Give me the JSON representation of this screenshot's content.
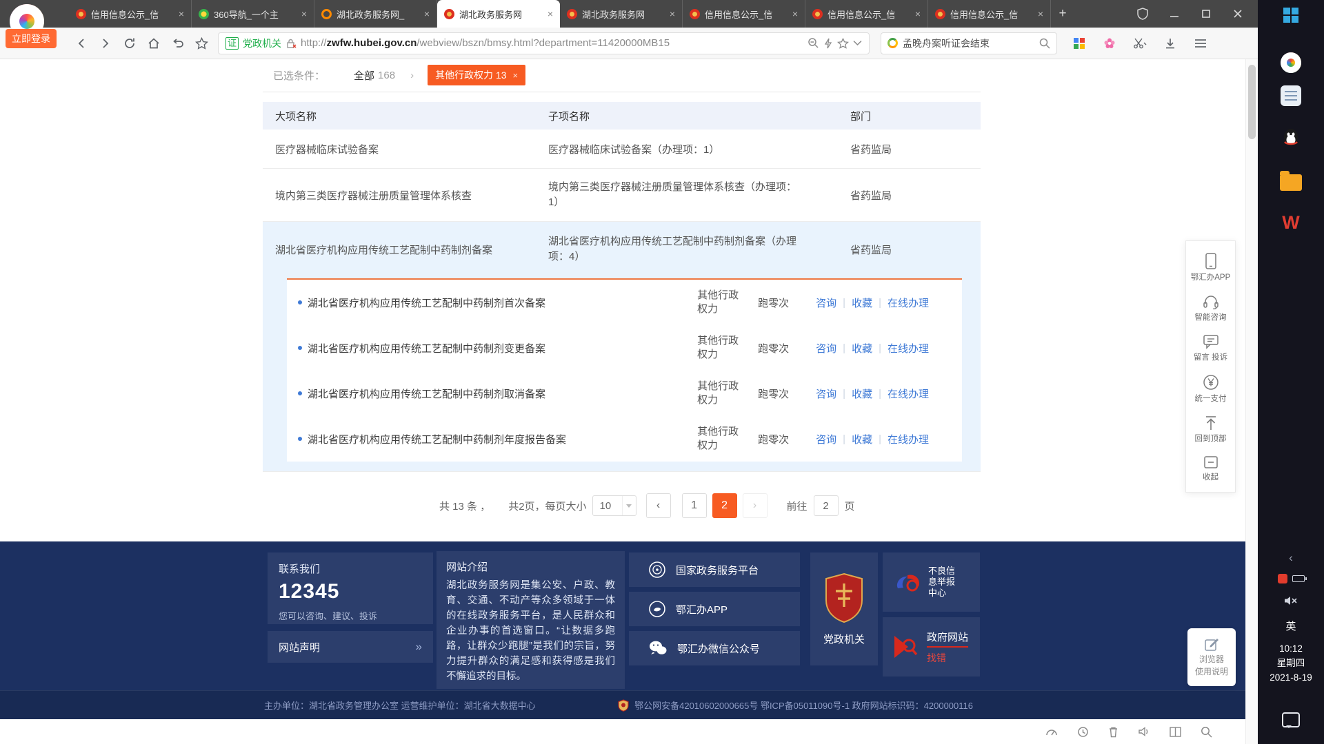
{
  "browser": {
    "login_button": "立即登录",
    "new_tab": "+",
    "tabs": [
      {
        "title": "信用信息公示_信",
        "close": "×"
      },
      {
        "title": "360导航_一个主",
        "close": "×"
      },
      {
        "title": "湖北政务服务网_",
        "close": "×"
      },
      {
        "title": "湖北政务服务网",
        "close": "×"
      },
      {
        "title": "湖北政务服务网",
        "close": "×"
      },
      {
        "title": "信用信息公示_信",
        "close": "×"
      },
      {
        "title": "信用信息公示_信",
        "close": "×"
      },
      {
        "title": "信用信息公示_信",
        "close": "×"
      }
    ],
    "address": {
      "cert": "证",
      "org": "党政机关",
      "url_prefix": "http://",
      "url_host": "zwfw.hubei.gov.cn",
      "url_path": "/webview/bszn/bmsy.html?department=11420000MB15"
    },
    "search_query": "孟晚舟案听证会结束"
  },
  "page": {
    "filter_label": "已选条件：",
    "filter_all": "全部",
    "filter_all_count": "168",
    "filter_sep": "›",
    "filter_tag": "其他行政权力 13",
    "filter_tag_close": "×",
    "headers": [
      "大项名称",
      "子项名称",
      "部门"
    ],
    "rows": [
      {
        "major": "医疗器械临床试验备案",
        "sub": "医疗器械临床试验备案（办理项：1）",
        "dept": "省药监局"
      },
      {
        "major": "境内第三类医疗器械注册质量管理体系核查",
        "sub": "境内第三类医疗器械注册质量管理体系核查（办理项：1）",
        "dept": "省药监局"
      },
      {
        "major": "湖北省医疗机构应用传统工艺配制中药制剂备案",
        "sub": "湖北省医疗机构应用传统工艺配制中药制剂备案（办理项：4）",
        "dept": "省药监局"
      }
    ],
    "action_sep": "|",
    "sub_items": [
      {
        "name": "湖北省医疗机构应用传统工艺配制中药制剂首次备案",
        "type": "其他行政权力",
        "visit": "跑零次",
        "a1": "咨询",
        "a2": "收藏",
        "a3": "在线办理"
      },
      {
        "name": "湖北省医疗机构应用传统工艺配制中药制剂变更备案",
        "type": "其他行政权力",
        "visit": "跑零次",
        "a1": "咨询",
        "a2": "收藏",
        "a3": "在线办理"
      },
      {
        "name": "湖北省医疗机构应用传统工艺配制中药制剂取消备案",
        "type": "其他行政权力",
        "visit": "跑零次",
        "a1": "咨询",
        "a2": "收藏",
        "a3": "在线办理"
      },
      {
        "name": "湖北省医疗机构应用传统工艺配制中药制剂年度报告备案",
        "type": "其他行政权力",
        "visit": "跑零次",
        "a1": "咨询",
        "a2": "收藏",
        "a3": "在线办理"
      }
    ],
    "pagination": {
      "total": "共 13 条 ，",
      "info": "共2页，每页大小",
      "size": "10",
      "prev": "‹",
      "p1": "1",
      "p2": "2",
      "next": "›",
      "goto_label": "前往",
      "goto_value": "2",
      "goto_unit": "页"
    }
  },
  "footer": {
    "contact_title": "联系我们",
    "hotline": "12345",
    "contact_desc": "您可以咨询、建议、投诉",
    "statement": "网站声明",
    "statement_arrow": "»",
    "about_title": "网站介绍",
    "about_text": "湖北政务服务网是集公安、户政、教育、交通、不动产等众多领域于一体的在线政务服务平台，是人民群众和企业办事的首选窗口。“让数据多跑路，让群众少跑腿”是我们的宗旨，努力提升群众的满足感和获得感是我们不懈追求的目标。",
    "link1": "国家政务服务平台",
    "link2": "鄂汇办APP",
    "link3": "鄂汇办微信公众号",
    "badge_label": "党政机关",
    "report_center": "不良信息举报中心",
    "site_error_main": "政府网站",
    "site_error_sub": "找错",
    "sponsor": "主办单位：湖北省政务管理办公室 运营维护单位：湖北省大数据中心",
    "beian": "鄂公网安备42010602000665号 鄂ICP备05011090号-1 政府网站标识码：4200000116"
  },
  "side_panel": {
    "item1": "鄂汇办APP",
    "item2": "智能咨询",
    "item3": "留言 投诉",
    "item4": "统一支付",
    "item5": "回到顶部",
    "item6": "收起"
  },
  "help_box": {
    "line1": "浏览器",
    "line2": "使用说明"
  },
  "taskbar": {
    "lang": "英",
    "time": "10:12",
    "weekday": "星期四",
    "date": "2021-8-19"
  }
}
